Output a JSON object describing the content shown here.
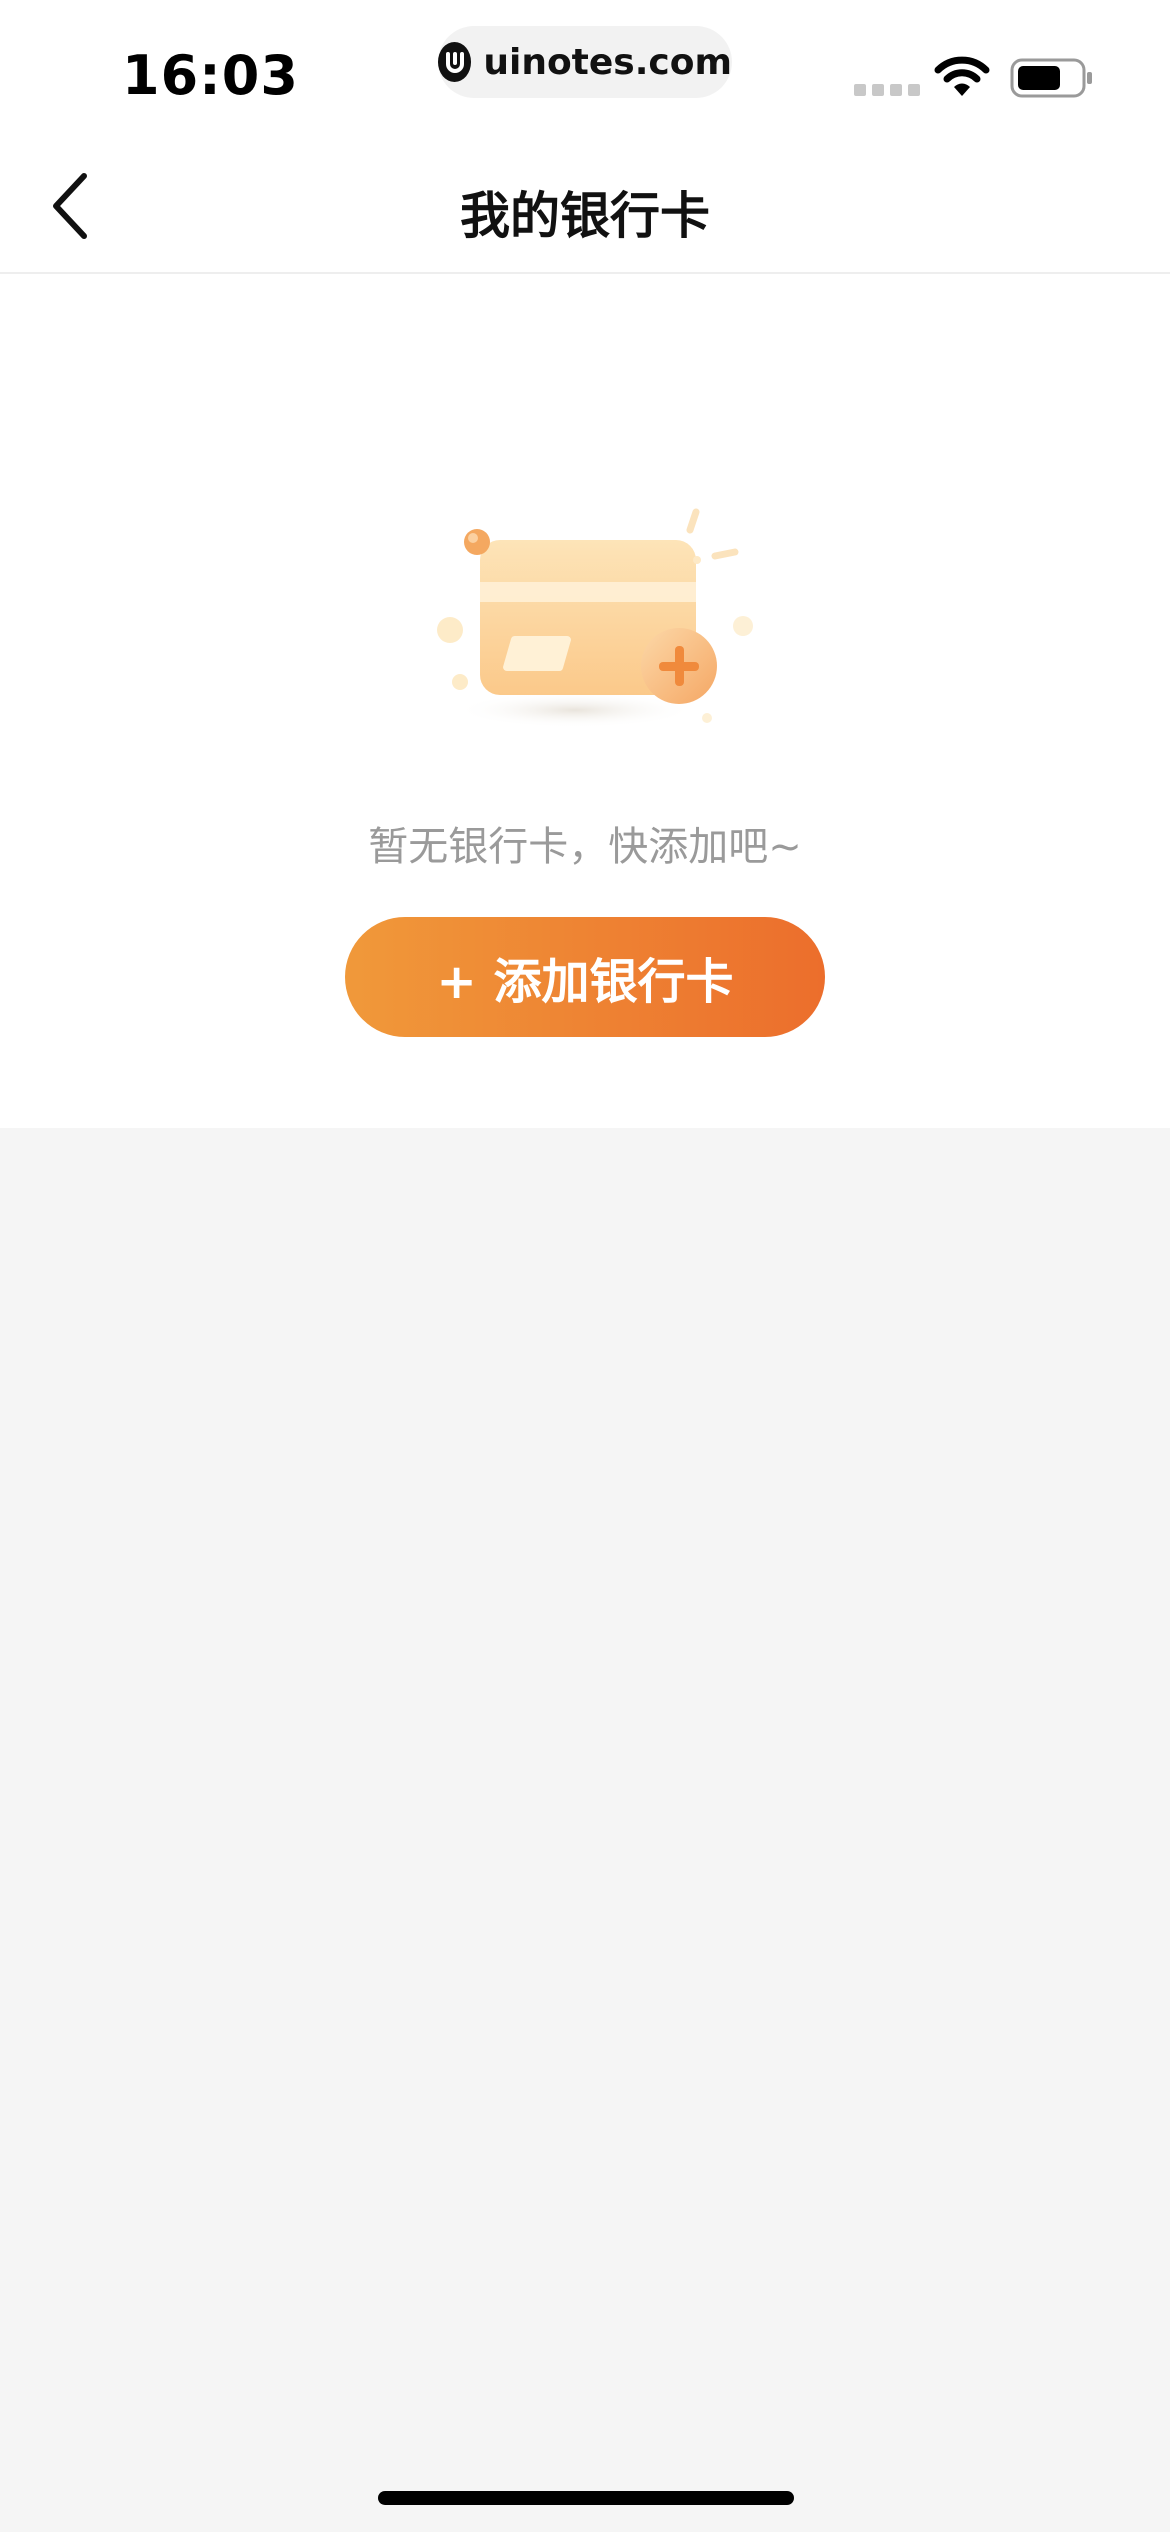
{
  "status_bar": {
    "time": "16:03",
    "url": "uinotes.com"
  },
  "nav": {
    "title": "我的银行卡"
  },
  "empty_state": {
    "message": "暂无银行卡，快添加吧~",
    "add_button_label": "+ 添加银行卡"
  },
  "colors": {
    "accent_start": "#f0993a",
    "accent_end": "#ec6e2c",
    "muted_text": "#9a9a9a",
    "page_bg": "#f5f5f5"
  },
  "icons": {
    "back": "chevron-left-icon",
    "illustration": "bank-card-add-illustration"
  }
}
